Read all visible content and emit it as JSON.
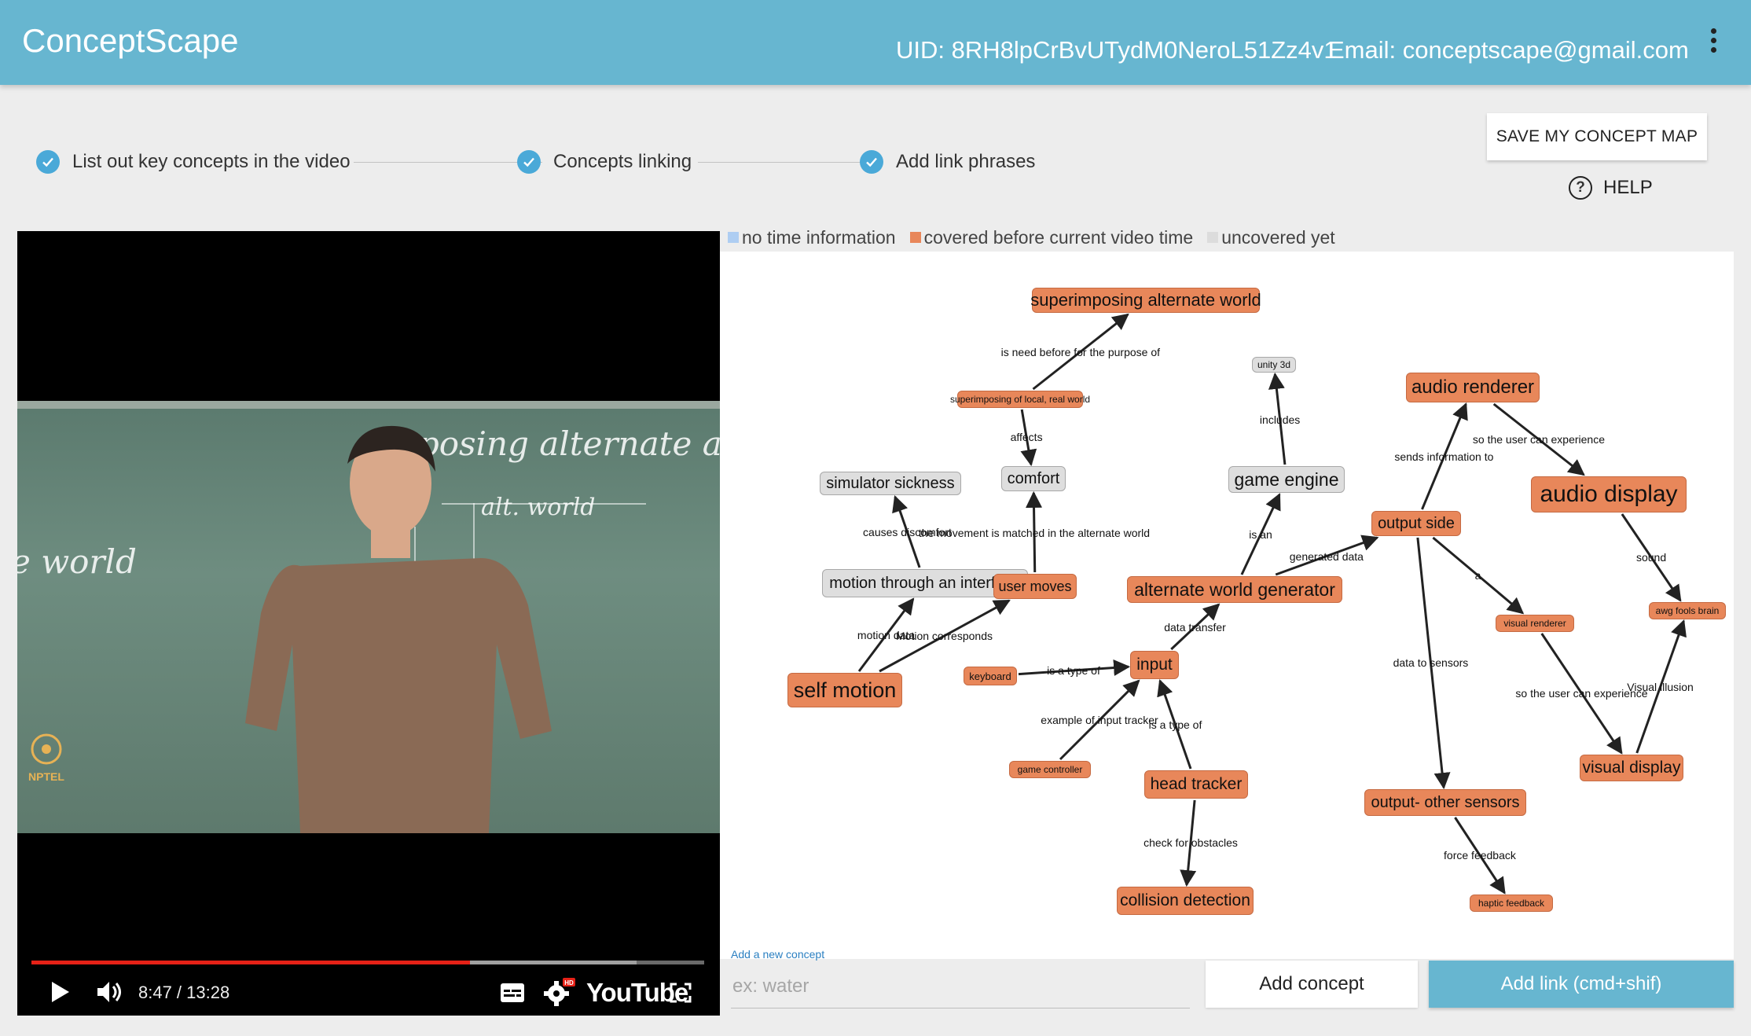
{
  "app": {
    "title": "ConceptScape",
    "uid_text": "UID: 8RH8lpCrBvUTydM0NeroL51Zz4v1",
    "email_text": "Email: conceptscape@gmail.com"
  },
  "steps": [
    {
      "label": "List out key concepts in the video",
      "done": true
    },
    {
      "label": "Concepts linking",
      "done": true
    },
    {
      "label": "Add link phrases",
      "done": true
    }
  ],
  "actions": {
    "save_label": "SAVE MY CONCEPT MAP",
    "help_label": "HELP",
    "add_concept_label": "Add concept",
    "add_link_label": "Add link (cmd+shif)"
  },
  "video": {
    "time_text": "8:47 / 13:28",
    "progress": 0.652,
    "buffered": 0.9,
    "brand": "YouTube",
    "channel_watermark": "NPTEL",
    "board_text": [
      "mposing  alternate and  local re",
      "e world",
      "alt. world"
    ],
    "hd_badge": "HD"
  },
  "legend": [
    {
      "label": "no time information",
      "color": "#aecdf2"
    },
    {
      "label": "covered before current video time",
      "color": "#e8875a"
    },
    {
      "label": "uncovered yet",
      "color": "#dcdcdc"
    }
  ],
  "concept_input": {
    "hint": "Add a new concept",
    "placeholder": "ex: water"
  },
  "concept_map": {
    "nodes": [
      {
        "id": "superimposing",
        "label": "superimposing alternate world",
        "status": "covered"
      },
      {
        "id": "superimposing_local",
        "label": "superimposing of local, real world",
        "status": "covered"
      },
      {
        "id": "simulator_sickness",
        "label": "simulator sickness",
        "status": "uncovered"
      },
      {
        "id": "comfort",
        "label": "comfort",
        "status": "uncovered"
      },
      {
        "id": "unity",
        "label": "unity 3d",
        "status": "uncovered"
      },
      {
        "id": "game_engine",
        "label": "game engine",
        "status": "uncovered"
      },
      {
        "id": "audio_renderer",
        "label": "audio renderer",
        "status": "covered"
      },
      {
        "id": "audio_display",
        "label": "audio display",
        "status": "covered"
      },
      {
        "id": "output_side",
        "label": "output side",
        "status": "covered"
      },
      {
        "id": "motion_interface",
        "label": "motion through an interface",
        "status": "uncovered"
      },
      {
        "id": "user_moves",
        "label": "user moves",
        "status": "covered"
      },
      {
        "id": "awg",
        "label": "alternate world generator",
        "status": "covered"
      },
      {
        "id": "visual_renderer",
        "label": "visual renderer",
        "status": "covered"
      },
      {
        "id": "awg_fools",
        "label": "awg fools brain",
        "status": "covered"
      },
      {
        "id": "self_motion",
        "label": "self motion",
        "status": "covered"
      },
      {
        "id": "keyboard",
        "label": "keyboard",
        "status": "covered"
      },
      {
        "id": "input",
        "label": "input",
        "status": "covered"
      },
      {
        "id": "game_controller",
        "label": "game controller",
        "status": "covered"
      },
      {
        "id": "head_tracker",
        "label": "head tracker",
        "status": "covered"
      },
      {
        "id": "visual_display",
        "label": "visual display",
        "status": "covered"
      },
      {
        "id": "output_other",
        "label": "output- other sensors",
        "status": "covered"
      },
      {
        "id": "haptic",
        "label": "haptic feedback",
        "status": "covered"
      },
      {
        "id": "collision",
        "label": "collision detection",
        "status": "covered"
      }
    ],
    "edges": [
      {
        "from": "superimposing_local",
        "to": "superimposing",
        "label": "is need before for the purpose of"
      },
      {
        "from": "superimposing_local",
        "to": "comfort",
        "label": "affects"
      },
      {
        "from": "motion_interface",
        "to": "simulator_sickness",
        "label": "causes discomfort"
      },
      {
        "from": "user_moves",
        "to": "comfort",
        "label": "the movement is matched in the alternate world"
      },
      {
        "from": "game_engine",
        "to": "unity",
        "label": "includes"
      },
      {
        "from": "awg",
        "to": "game_engine",
        "label": "is an"
      },
      {
        "from": "awg",
        "to": "output_side",
        "label": "generated data"
      },
      {
        "from": "output_side",
        "to": "audio_renderer",
        "label": "sends information to"
      },
      {
        "from": "audio_renderer",
        "to": "audio_display",
        "label": "so the user can experience"
      },
      {
        "from": "output_side",
        "to": "visual_renderer",
        "label": "a"
      },
      {
        "from": "audio_display",
        "to": "awg_fools",
        "label": "sound"
      },
      {
        "from": "self_motion",
        "to": "motion_interface",
        "label": "motion data"
      },
      {
        "from": "self_motion",
        "to": "user_moves",
        "label": "Motion corresponds"
      },
      {
        "from": "input",
        "to": "awg",
        "label": "data transfer"
      },
      {
        "from": "keyboard",
        "to": "input",
        "label": "is a type of"
      },
      {
        "from": "game_controller",
        "to": "input",
        "label": "example of input tracker"
      },
      {
        "from": "head_tracker",
        "to": "input",
        "label": "is a type of"
      },
      {
        "from": "output_side",
        "to": "output_other",
        "label": "data to sensors"
      },
      {
        "from": "visual_renderer",
        "to": "visual_display",
        "label": "so the user can experience"
      },
      {
        "from": "visual_display",
        "to": "awg_fools",
        "label": "Visual illusion"
      },
      {
        "from": "output_other",
        "to": "haptic",
        "label": "force feedback"
      },
      {
        "from": "head_tracker",
        "to": "collision",
        "label": "check for obstacles"
      }
    ]
  }
}
